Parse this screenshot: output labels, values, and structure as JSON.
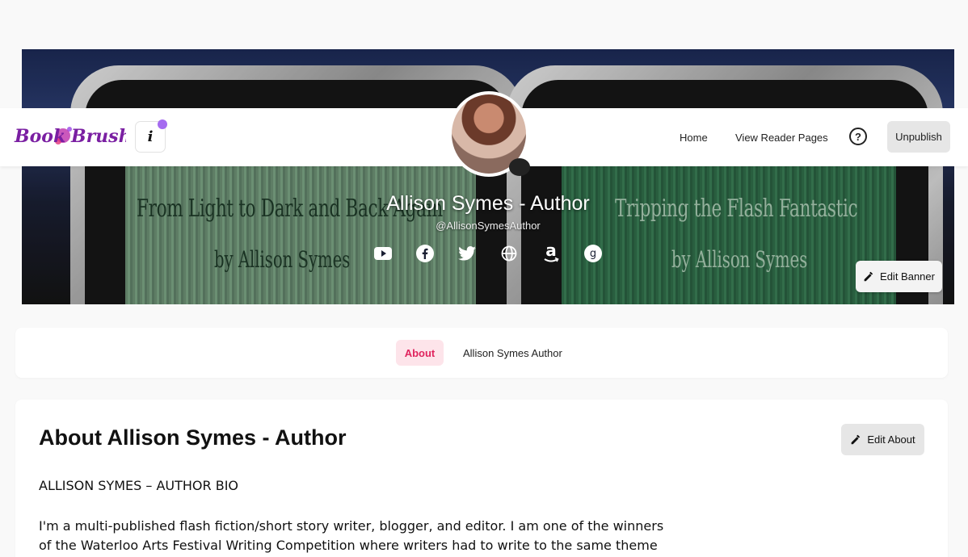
{
  "header": {
    "logo_text": "Book Brush",
    "info_label": "i",
    "nav": {
      "home": "Home",
      "reader_pages": "View Reader Pages"
    },
    "help_label": "?",
    "unpublish_label": "Unpublish"
  },
  "banner": {
    "author_name": "Allison Symes - Author",
    "handle": "@AllisonSymesAuthor",
    "edit_label": "Edit Banner",
    "book_left": {
      "title": "From Light to Dark and Back Again",
      "byline": "by Allison Symes"
    },
    "book_right": {
      "title": "Tripping the Flash Fantastic",
      "byline": "by Allison Symes"
    },
    "social_icons": [
      "youtube-icon",
      "facebook-icon",
      "twitter-icon",
      "globe-icon",
      "amazon-icon",
      "goodreads-icon"
    ]
  },
  "tabs": {
    "about": "About",
    "author": "Allison Symes Author"
  },
  "about": {
    "title": "About Allison Symes - Author",
    "edit_label": "Edit About",
    "bio_heading": "ALLISON SYMES – AUTHOR BIO",
    "bio_text": "I'm a multi-published flash fiction/short story writer, blogger, and editor. I am one of the winners of the Waterloo Arts Festival Writing Competition where writers had to write to the same theme"
  },
  "colors": {
    "accent": "#e0245e",
    "accent_bg": "#fde4ea",
    "notification_dot": "#a56bf0",
    "logo": "#7a1fa2"
  }
}
